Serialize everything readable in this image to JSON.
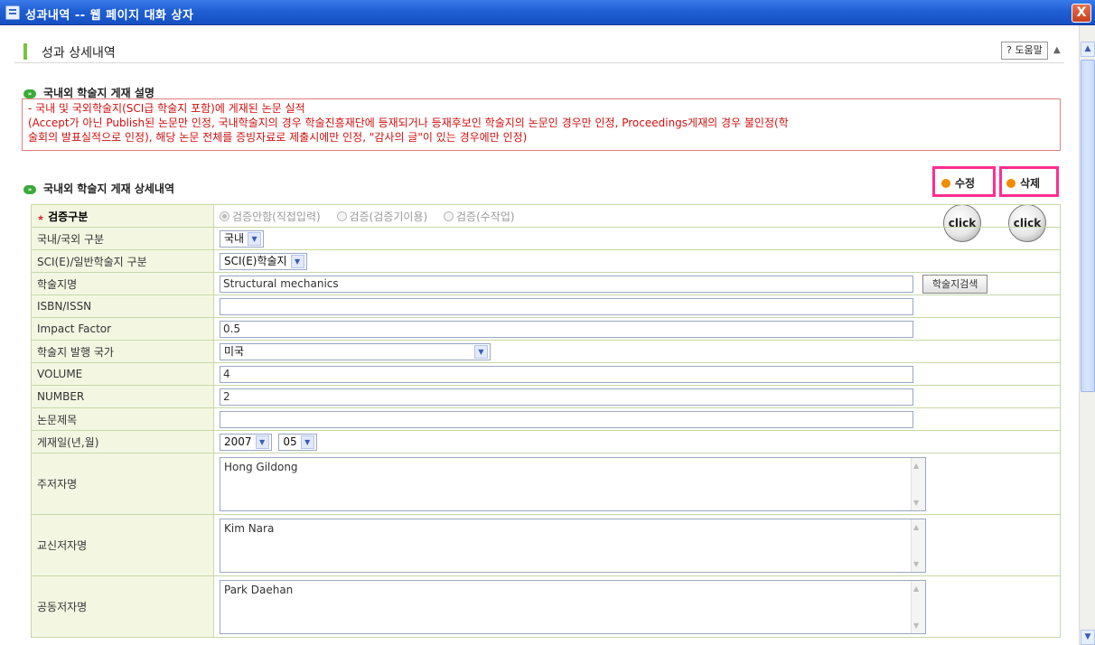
{
  "window": {
    "title": "성과내역 -- 웹 페이지 대화 상자",
    "close_label": "X"
  },
  "header": {
    "title": "성과 상세내역",
    "help_label": "? 도움말"
  },
  "sections": {
    "description_title": "국내외 학술지 게재 설명",
    "description_lines": [
      "- 국내 및 국외학술지(SCI급 학술지 포함)에 게재된 논문 실적",
      "(Accept가 아닌 Publish된 논문만 인정, 국내학술지의 경우 학술진흥재단에 등재되거나 등재후보인 학술지의 논문인 경우만 인정, Proceedings게재의 경우 불인정(학",
      "술회의 발표실적으로 인정), 해당 논문 전체를 증빙자료로 제출시에만 인정, \"감사의 글\"이 있는 경우에만 인정)"
    ],
    "detail_title": "국내외 학술지 게재 상세내역"
  },
  "actions": {
    "edit_label": "수정",
    "delete_label": "삭제",
    "click_label": "click"
  },
  "form": {
    "verify": {
      "label": "검증구분",
      "options": [
        "검증안함(직접입력)",
        "검증(검증기이용)",
        "검증(수작업)"
      ]
    },
    "domestic": {
      "label": "국내/국외 구분",
      "value": "국내"
    },
    "sci": {
      "label": "SCI(E)/일반학술지 구분",
      "value": "SCI(E)학술지"
    },
    "journal": {
      "label": "학술지명",
      "value": "Structural mechanics",
      "search_label": "학술지검색"
    },
    "isbn": {
      "label": "ISBN/ISSN",
      "value": ""
    },
    "impact": {
      "label": "Impact Factor",
      "value": "0.5"
    },
    "country": {
      "label": "학술지 발행 국가",
      "value": "미국"
    },
    "volume": {
      "label": "VOLUME",
      "value": "4"
    },
    "number": {
      "label": "NUMBER",
      "value": "2"
    },
    "paper_title": {
      "label": "논문제목",
      "value": ""
    },
    "pub_date": {
      "label": "게재일(년,월)",
      "year": "2007",
      "month": "05"
    },
    "main_author": {
      "label": "주저자명",
      "value": "Hong Gildong"
    },
    "corr_author": {
      "label": "교신저자명",
      "value": "Kim Nara"
    },
    "co_author": {
      "label": "공동저자명",
      "value": "Park Daehan"
    }
  },
  "colors": {
    "accent_frame": "#ff2d8f",
    "title_bar": "#1f5fd4",
    "desc_text": "#d01010",
    "label_bg": "#f3f7e2"
  }
}
